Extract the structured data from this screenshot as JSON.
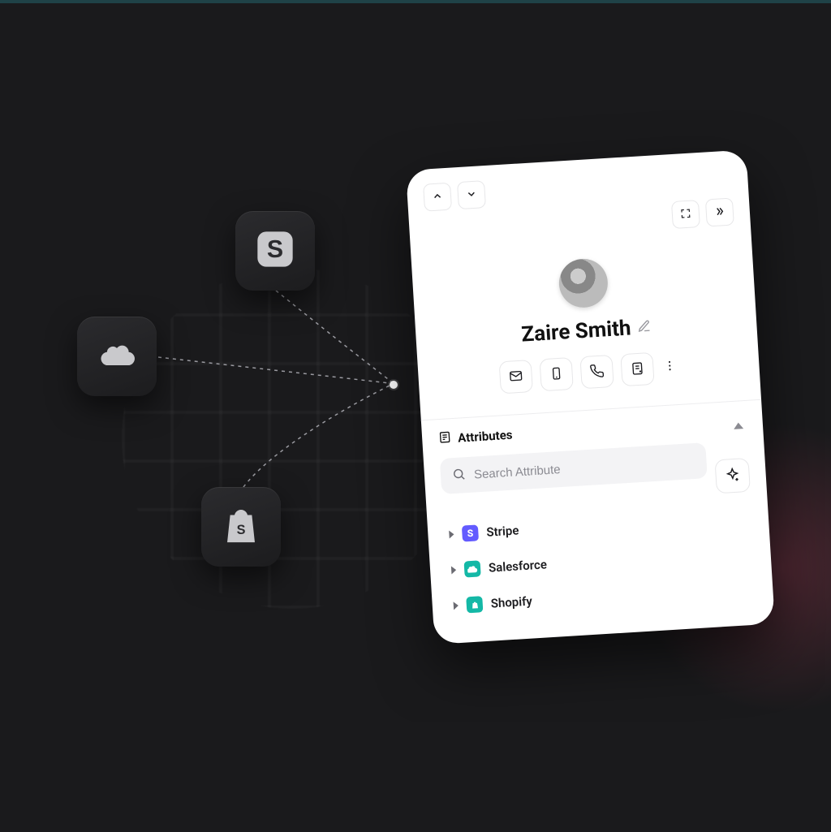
{
  "profile": {
    "name": "Zaire Smith"
  },
  "section": {
    "attributes_label": "Attributes"
  },
  "search": {
    "placeholder": "Search Attribute"
  },
  "attributes": {
    "items": [
      {
        "label": "Stripe"
      },
      {
        "label": "Salesforce"
      },
      {
        "label": "Shopify"
      }
    ]
  }
}
